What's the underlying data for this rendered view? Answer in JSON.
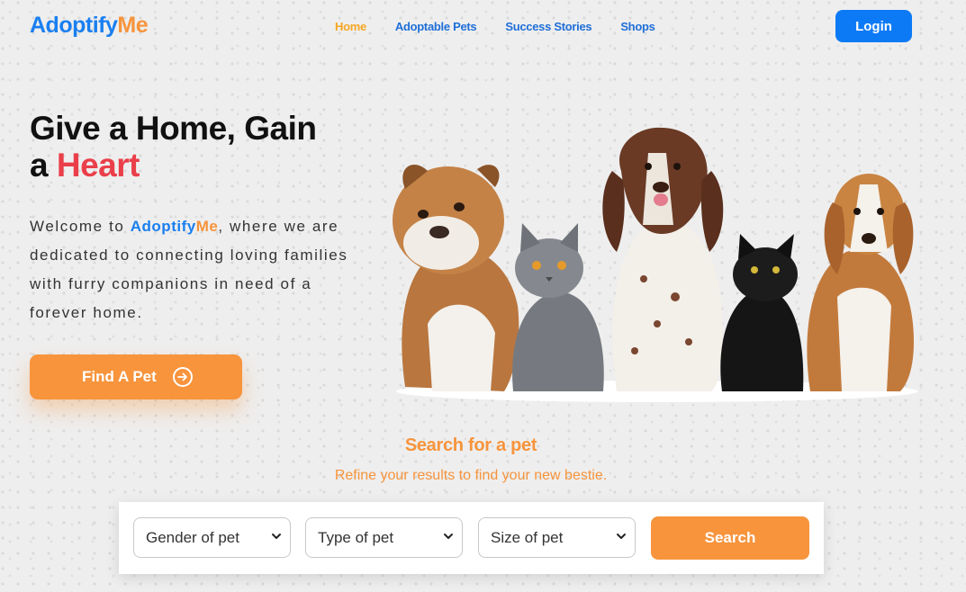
{
  "brand": {
    "part1": "Adoptify",
    "part2": "Me"
  },
  "nav": {
    "items": [
      {
        "label": "Home",
        "active": true
      },
      {
        "label": "Adoptable Pets",
        "active": false
      },
      {
        "label": "Success Stories",
        "active": false
      },
      {
        "label": "Shops",
        "active": false
      }
    ],
    "login_label": "Login"
  },
  "hero": {
    "title_line1": "Give a Home, Gain",
    "title_line2_prefix": "a ",
    "title_highlight": "Heart",
    "desc_prefix": "Welcome to ",
    "desc_brand1": "Adoptify",
    "desc_brand2": "Me",
    "desc_suffix": ", where we are dedicated to connecting loving families with furry companions in need of a forever home.",
    "cta_label": "Find A Pet"
  },
  "search": {
    "title": "Search for a pet",
    "subtitle": "Refine your results to find your new bestie.",
    "gender_selected": "Gender of pet",
    "type_selected": "Type of pet",
    "size_selected": "Size of pet",
    "button_label": "Search"
  },
  "colors": {
    "primary_blue": "#0d7af5",
    "accent_orange": "#f7943c",
    "heart_red": "#ea3f4a",
    "nav_active": "#f5a623"
  }
}
